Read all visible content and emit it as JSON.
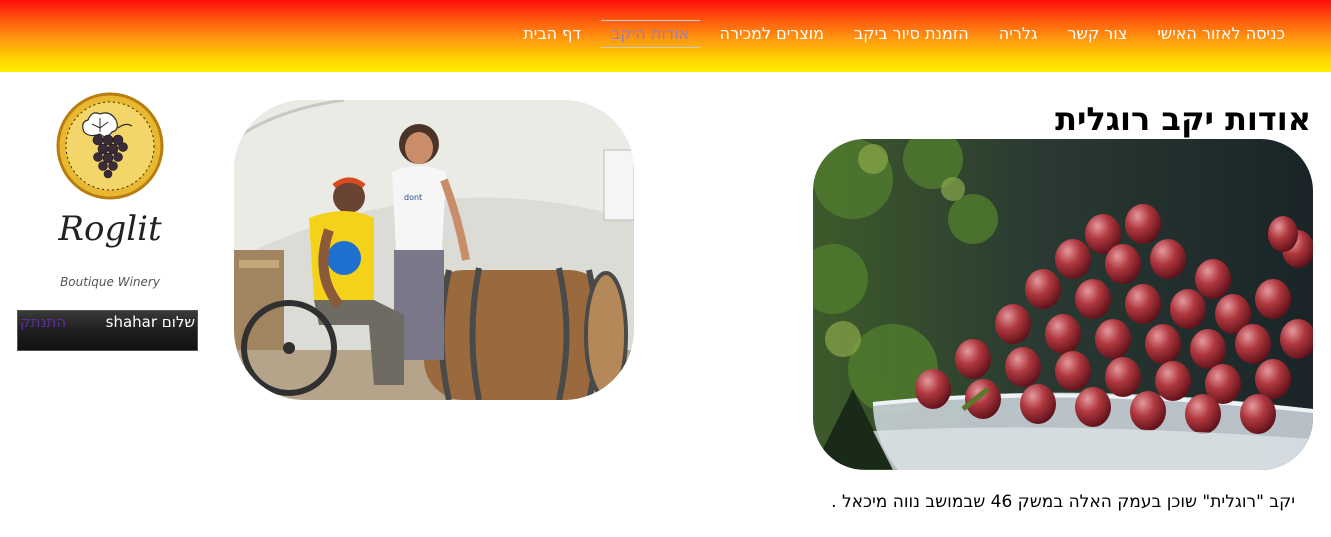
{
  "nav": {
    "items": [
      {
        "label": "דף הבית",
        "active": false
      },
      {
        "label": "אודות היקב",
        "active": true
      },
      {
        "label": "מוצרים למכירה",
        "active": false
      },
      {
        "label": "הזמנת סיור ביקב",
        "active": false
      },
      {
        "label": "גלריה",
        "active": false
      },
      {
        "label": "צור קשר",
        "active": false
      },
      {
        "label": "כניסה לאזור האישי",
        "active": false
      }
    ]
  },
  "logo": {
    "name": "Roglit",
    "tagline": "Boutique Winery"
  },
  "user_bar": {
    "greeting": "שלום shahar",
    "logout_label": "התנתק"
  },
  "page": {
    "title": "אודות יקב רוגלית",
    "text": "יקב \"רוגלית\" שוכן בעמק האלה במשק 46 שבמושב נווה מיכאל ."
  },
  "colors": {
    "nav_gradient_top": "#ff0d0d",
    "nav_gradient_bottom": "#ffee00",
    "nav_active_text": "#9b7fb5",
    "logout_link": "#5b2d9a"
  }
}
